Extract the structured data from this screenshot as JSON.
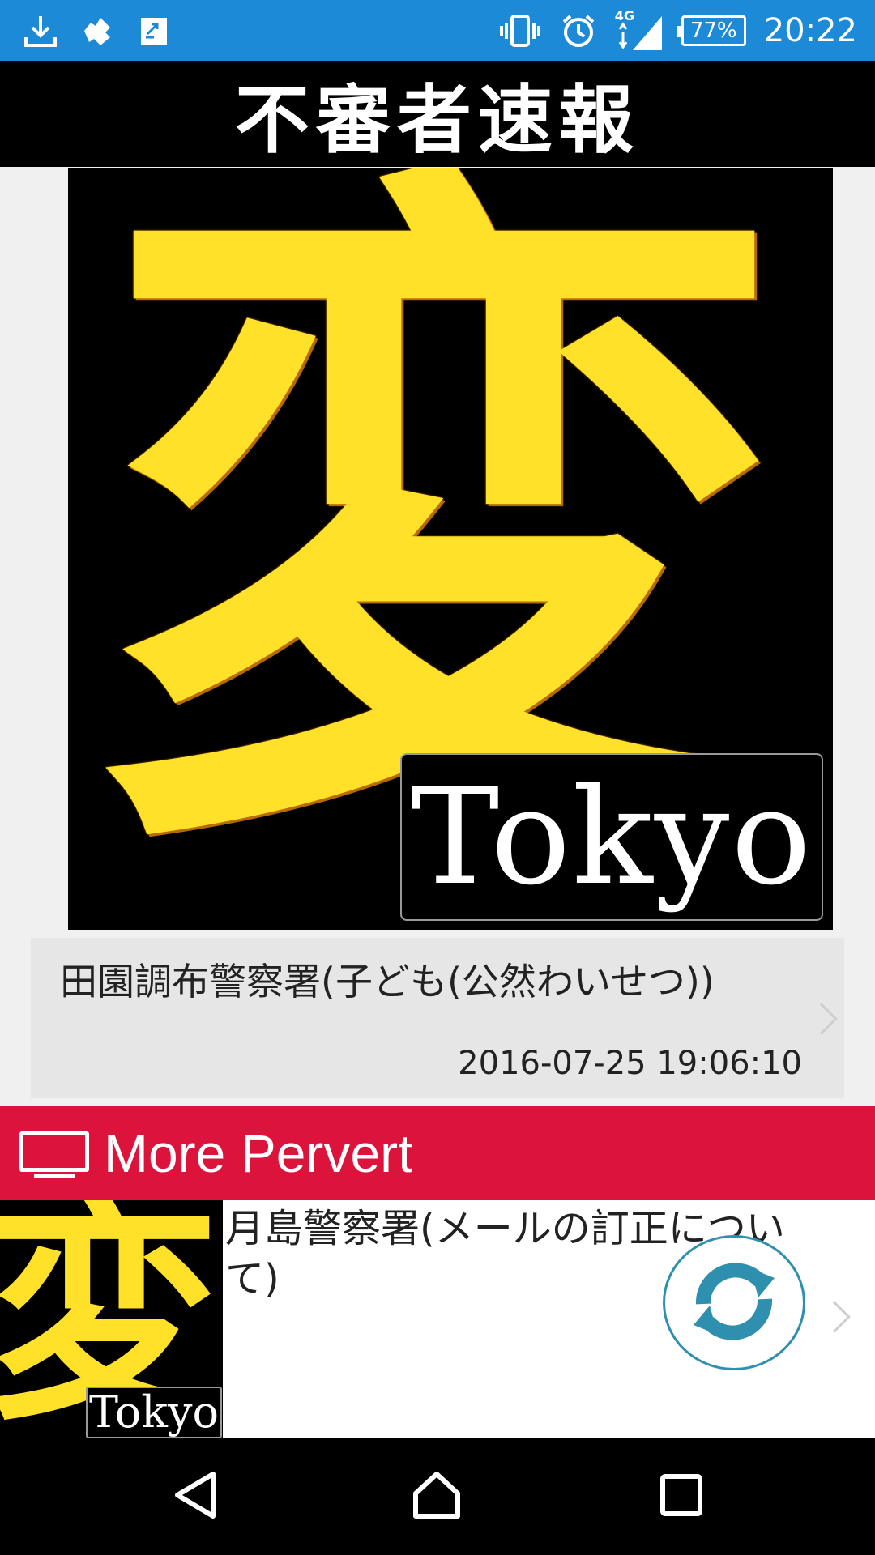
{
  "status_bar": {
    "icons_left": [
      "download-icon",
      "puzzle-icon",
      "transfer-icon"
    ],
    "icons_right": [
      "vibrate-icon",
      "alarm-icon",
      "signal-4g-icon"
    ],
    "network": "4G",
    "battery": "77%",
    "time": "20:22"
  },
  "header": {
    "title": "不審者速報"
  },
  "hero": {
    "glyph": "変",
    "badge": "Tokyo"
  },
  "featured": {
    "title": "田園調布警察署(子ども(公然わいせつ))",
    "date": "2016-07-25 19:06:10"
  },
  "section": {
    "icon": "tv-icon",
    "label": "More Pervert"
  },
  "list": {
    "items": [
      {
        "thumb_glyph": "変",
        "thumb_badge": "Tokyo",
        "title": "月島警察署(メールの訂正について)"
      }
    ]
  },
  "fab": {
    "icon": "refresh-icon",
    "colors": {
      "accent": "#2f8fae"
    }
  },
  "nav": {
    "buttons": [
      "back-icon",
      "home-icon",
      "recents-icon"
    ]
  },
  "colors": {
    "status_bar": "#1c8ad6",
    "section_header": "#dc143c",
    "logo_yellow": "#ffe12a"
  }
}
